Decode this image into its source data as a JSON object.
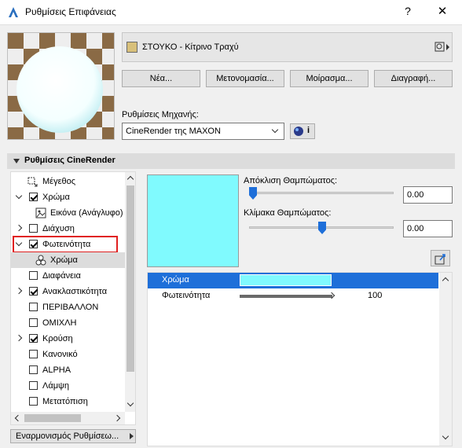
{
  "window": {
    "title": "Ρυθμίσεις Επιφάνειας",
    "help_label": "?",
    "close_label": "✕"
  },
  "surface": {
    "name": "ΣΤΟΥΚΟ - Κίτρινο Τραχύ",
    "swatch_color": "#d8c07a"
  },
  "buttons": {
    "new": "Νέα...",
    "rename": "Μετονομασία...",
    "share": "Μοίρασμα...",
    "delete": "Διαγραφή..."
  },
  "engine": {
    "label": "Ρυθμίσεις Μηχανής:",
    "value": "CineRender της MAXON",
    "info_label": "i"
  },
  "section": {
    "title": "Ρυθμίσεις CineRender"
  },
  "tree": [
    {
      "label": "Μέγεθος",
      "check": "none",
      "expander": "none",
      "icon": "size-icon",
      "indent": 1
    },
    {
      "label": "Χρώμα",
      "check": "checked",
      "expander": "down",
      "indent": 1
    },
    {
      "label": "Εικόνα (Ανάγλυφο)",
      "check": "none",
      "expander": "none",
      "icon": "image-icon",
      "indent": 2
    },
    {
      "label": "Διάχυση",
      "check": "unchecked",
      "expander": "right",
      "indent": 1
    },
    {
      "label": "Φωτεινότητα",
      "check": "checked",
      "expander": "down",
      "indent": 1,
      "highlighted": true
    },
    {
      "label": "Χρώμα",
      "check": "none",
      "expander": "none",
      "icon": "nodes-icon",
      "indent": 2,
      "selected": true
    },
    {
      "label": "Διαφάνεια",
      "check": "unchecked",
      "expander": "none",
      "indent": 1
    },
    {
      "label": "Ανακλαστικότητα",
      "check": "checked",
      "expander": "right",
      "indent": 1
    },
    {
      "label": "ΠΕΡΙΒΑΛΛΟΝ",
      "check": "unchecked",
      "expander": "none",
      "indent": 1
    },
    {
      "label": "ΟΜΙΧΛΗ",
      "check": "unchecked",
      "expander": "none",
      "indent": 1
    },
    {
      "label": "Κρούση",
      "check": "checked",
      "expander": "right",
      "indent": 1
    },
    {
      "label": "Κανονικό",
      "check": "unchecked",
      "expander": "none",
      "indent": 1
    },
    {
      "label": "ALPHA",
      "check": "unchecked",
      "expander": "none",
      "indent": 1
    },
    {
      "label": "Λάμψη",
      "check": "unchecked",
      "expander": "none",
      "indent": 1
    },
    {
      "label": "Μετατόπιση",
      "check": "unchecked",
      "expander": "none",
      "indent": 1
    }
  ],
  "harmonize": {
    "label": "Εναρμονισμός Ρυθμίσεω..."
  },
  "preview_color": "#80fafe",
  "blur_offset": {
    "label": "Απόκλιση Θαμπώματος:",
    "value": "0.00",
    "level": 0
  },
  "blur_scale": {
    "label": "Κλίμακα Θαμπώματος:",
    "value": "0.00",
    "level": 0.5
  },
  "params": [
    {
      "label": "Χρώμα",
      "kind": "color",
      "color": "#80fafe"
    },
    {
      "label": "Φωτεινότητα",
      "kind": "slider",
      "value": "100",
      "level": 1.0
    }
  ]
}
